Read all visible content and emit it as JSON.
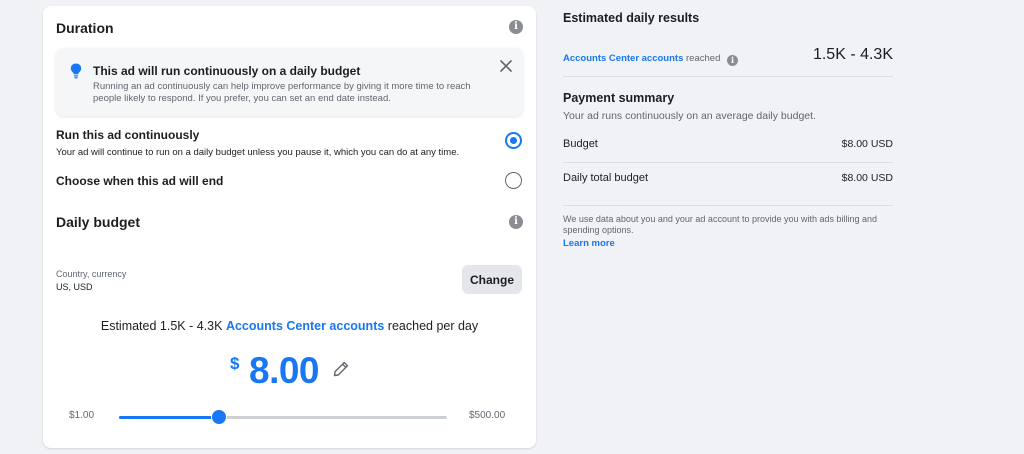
{
  "duration": {
    "title": "Duration",
    "notice": {
      "title": "This ad will run continuously on a daily budget",
      "body": "Running an ad continuously can help improve performance by giving it more time to reach people likely to respond. If you prefer, you can set an end date instead."
    },
    "options": [
      {
        "title": "Run this ad continuously",
        "description": "Your ad will continue to run on a daily budget unless you pause it, which you can do at any time.",
        "selected": true
      },
      {
        "title": "Choose when this ad will end",
        "description": "",
        "selected": false
      }
    ]
  },
  "daily_budget": {
    "title": "Daily budget",
    "country_currency_label": "Country, currency",
    "country_currency_value": "US, USD",
    "change_label": "Change",
    "estimate_prefix": "Estimated 1.5K - 4.3K",
    "estimate_link": "Accounts Center accounts",
    "estimate_suffix": "reached per day",
    "currency_symbol": "$",
    "amount": "8.00",
    "slider": {
      "min_label": "$1.00",
      "max_label": "$500.00",
      "fraction": 0.305
    }
  },
  "estimated_results": {
    "title": "Estimated daily results",
    "reach_link": "Accounts Center accounts",
    "reach_suffix": "reached",
    "reach_value": "1.5K - 4.3K"
  },
  "payment_summary": {
    "title": "Payment summary",
    "description": "Your ad runs continuously on an average daily budget.",
    "rows": [
      {
        "label": "Budget",
        "value": "$8.00 USD"
      },
      {
        "label": "Daily total budget",
        "value": "$8.00 USD"
      }
    ],
    "note": "We use data about you and your ad account to provide you with ads billing and spending options.",
    "learn_more": "Learn more"
  },
  "colors": {
    "accent": "#1877f2",
    "background": "#f0f2f5",
    "card": "#ffffff"
  },
  "icons": {
    "info": "info-icon",
    "bulb": "lightbulb-icon",
    "close": "close-icon",
    "edit": "pencil-icon"
  }
}
